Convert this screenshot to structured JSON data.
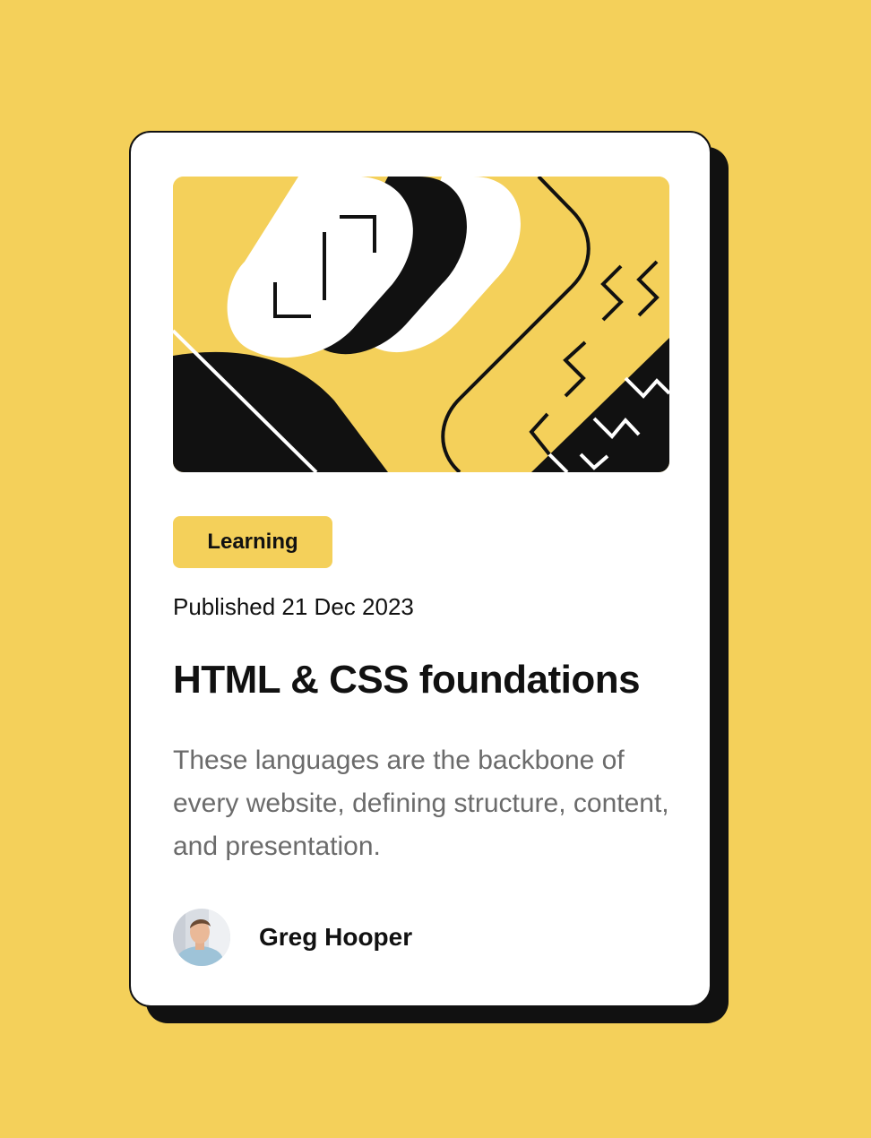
{
  "card": {
    "tag": "Learning",
    "published": "Published 21 Dec 2023",
    "title": "HTML & CSS foundations",
    "description": "These languages are the backbone of every website, defining structure, content, and presentation.",
    "author": {
      "name": "Greg Hooper",
      "avatar_icon": "person-avatar"
    },
    "illustration_icon": "abstract-illustration"
  },
  "colors": {
    "background": "#f4d05a",
    "card": "#ffffff",
    "ink": "#111111",
    "muted_text": "#6b6b6b"
  }
}
